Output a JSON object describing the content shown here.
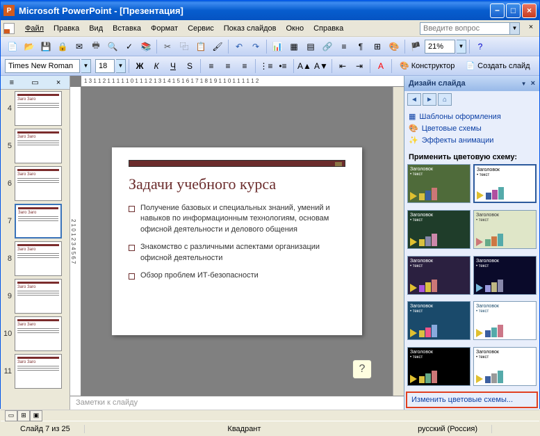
{
  "titlebar": {
    "title": "Microsoft PowerPoint - [Презентация]"
  },
  "menu": {
    "items": [
      "Файл",
      "Правка",
      "Вид",
      "Вставка",
      "Формат",
      "Сервис",
      "Показ слайдов",
      "Окно",
      "Справка"
    ],
    "help_placeholder": "Введите вопрос"
  },
  "toolbar1": {
    "zoom": "21%"
  },
  "toolbar2": {
    "font": "Times New Roman",
    "size": "18",
    "designer": "Конструктор",
    "new_slide": "Создать слайд"
  },
  "thumbs": {
    "numbers": [
      "4",
      "5",
      "6",
      "7",
      "8",
      "9",
      "10",
      "11"
    ],
    "selected": 3
  },
  "ruler": "1 3 1 1 2 1 1 1 1 1 0 1 1 1 2 1 3 1 4 1 5 1 6 1 7 1 8 1 9 1 1 0 1 1 1 1 1 2",
  "slide": {
    "title": "Задачи учебного курса",
    "bullets": [
      "Получение базовых и специальных знаний, умений и навыков по информационным технологиям, основам офисной деятельности и делового общения",
      "Знакомство с различными аспектами организации офисной деятельности",
      "Обзор проблем ИТ-безопасности"
    ]
  },
  "notes": {
    "placeholder": "Заметки к слайду"
  },
  "taskpane": {
    "title": "Дизайн слайда",
    "links": {
      "templates": "Шаблоны оформления",
      "color_schemes": "Цветовые схемы",
      "animation": "Эффекты анимации"
    },
    "section": "Применить цветовую схему:",
    "schemes": [
      {
        "bg": "#4f6b3a",
        "fg": "#fff",
        "header": "Заголовок",
        "sub": "текст",
        "bars": [
          "#d9c040",
          "#3b5fa0",
          "#c77"
        ],
        "arrow": "#e0c030"
      },
      {
        "bg": "#ffffff",
        "fg": "#000",
        "header": "Заголовок",
        "sub": "текст",
        "bars": [
          "#3b5fa0",
          "#b050a0",
          "#5aa"
        ],
        "arrow": "#e0c030",
        "selected": true
      },
      {
        "bg": "#1f3d2a",
        "fg": "#fff",
        "header": "Заголовок",
        "sub": "текст",
        "bars": [
          "#d9c040",
          "#88a",
          "#c8a"
        ],
        "arrow": "#e0c030"
      },
      {
        "bg": "#dfe6c8",
        "fg": "#333",
        "header": "Заголовок",
        "sub": "текст",
        "bars": [
          "#6a8",
          "#c74",
          "#5aa"
        ],
        "arrow": "#c77"
      },
      {
        "bg": "#2b2040",
        "fg": "#fff",
        "header": "Заголовок",
        "sub": "текст",
        "bars": [
          "#a5d",
          "#d9c040",
          "#c77"
        ],
        "arrow": "#e0c030"
      },
      {
        "bg": "#0a0a2a",
        "fg": "#fff",
        "header": "Заголовок",
        "sub": "текст",
        "bars": [
          "#99d",
          "#c0b884",
          "#88a"
        ],
        "arrow": "#7bd"
      },
      {
        "bg": "#1a4a6b",
        "fg": "#fff",
        "header": "Заголовок",
        "sub": "текст",
        "bars": [
          "#d9c040",
          "#e58",
          "#8ad"
        ],
        "arrow": "#e0c030"
      },
      {
        "bg": "#ffffff",
        "fg": "#1a4a6b",
        "header": "Заголовок",
        "sub": "текст",
        "bars": [
          "#3b5fa0",
          "#5aa",
          "#c78"
        ],
        "arrow": "#e0c030"
      },
      {
        "bg": "#000000",
        "fg": "#fff",
        "header": "Заголовок",
        "sub": "текст",
        "bars": [
          "#d9c040",
          "#6a8",
          "#c77"
        ],
        "arrow": "#e0c030"
      },
      {
        "bg": "#ffffff",
        "fg": "#000",
        "header": "Заголовок",
        "sub": "текст",
        "bars": [
          "#3b5fa0",
          "#999",
          "#5aa"
        ],
        "arrow": "#e0c030"
      }
    ],
    "footer_link": "Изменить цветовые схемы..."
  },
  "status": {
    "slide": "Слайд 7 из 25",
    "layout": "Квадрант",
    "lang": "русский (Россия)"
  },
  "help_bubble": "?"
}
